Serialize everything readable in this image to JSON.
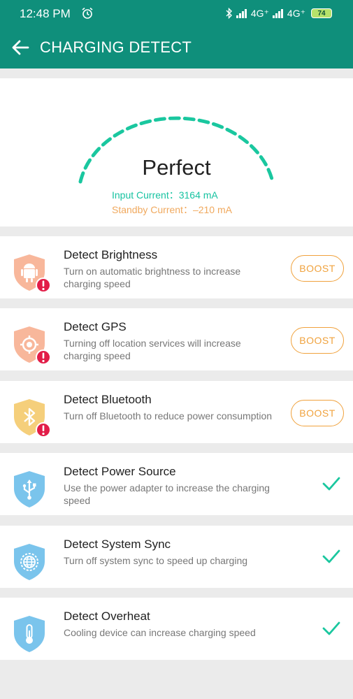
{
  "status_bar": {
    "time": "12:48 PM",
    "network_1": "4G⁺",
    "network_2": "4G⁺",
    "battery": "74"
  },
  "header": {
    "title": "CHARGING DETECT"
  },
  "gauge": {
    "status": "Perfect",
    "input_current": "Input Current：3164 mA",
    "standby_current": "Standby Current：–210 mA",
    "arc_color": "#1ac79f"
  },
  "items": [
    {
      "title": "Detect Brightness",
      "description": "Turn on automatic brightness to increase charging speed",
      "icon": "android-icon",
      "action": "BOOST"
    },
    {
      "title": "Detect GPS",
      "description": "Turning off location services will increase charging speed",
      "icon": "location-target-icon",
      "action": "BOOST"
    },
    {
      "title": "Detect Bluetooth",
      "description": "Turn off Bluetooth to reduce power consumption",
      "icon": "bluetooth-icon",
      "action": "BOOST"
    },
    {
      "title": "Detect Power Source",
      "description": "Use the power adapter to increase the charging speed",
      "icon": "usb-icon",
      "action": "done"
    },
    {
      "title": "Detect System Sync",
      "description": "Turn off system sync to speed up charging",
      "icon": "globe-icon",
      "action": "done"
    },
    {
      "title": "Detect Overheat",
      "description": "Cooling device can increase charging speed",
      "icon": "thermometer-icon",
      "action": "done"
    }
  ],
  "colors": {
    "header": "#0f8f7b",
    "warning_shield_orange": "#f8b79b",
    "warning_shield_yellow": "#f5cf7b",
    "ok_shield_blue": "#7ac4ec",
    "alert_badge": "#e21d48",
    "boost": "#f0a23d",
    "check": "#1ac79f"
  }
}
